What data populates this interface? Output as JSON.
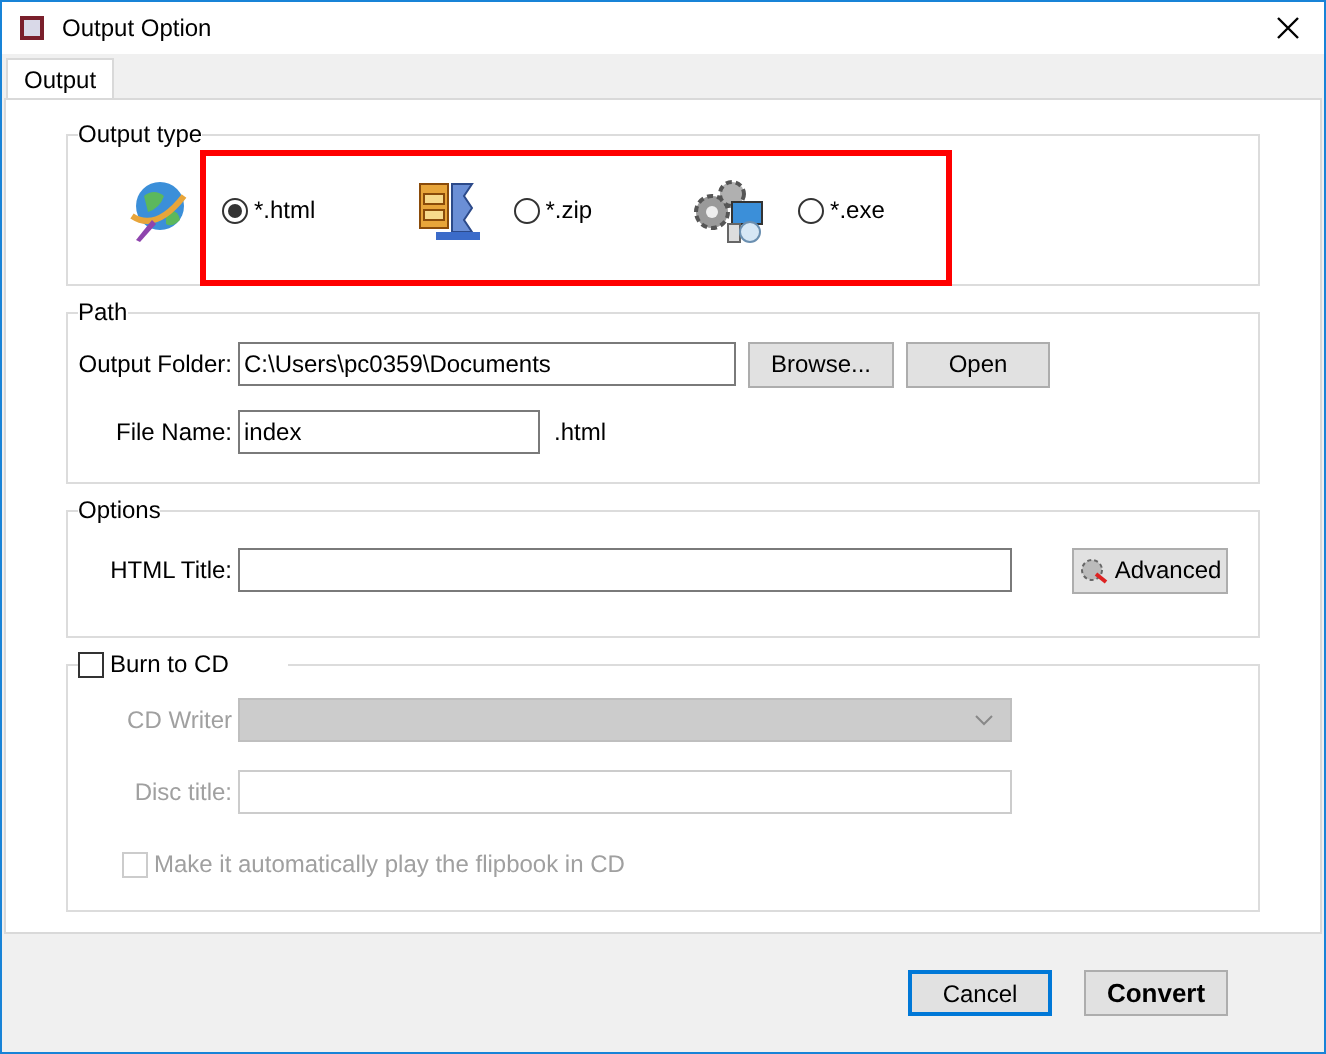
{
  "window": {
    "title": "Output Option"
  },
  "tabs": [
    {
      "label": "Output",
      "selected": true
    }
  ],
  "output_type": {
    "legend": "Output type",
    "options": [
      {
        "kind": "html",
        "label": "*.html",
        "selected": true
      },
      {
        "kind": "zip",
        "label": "*.zip",
        "selected": false
      },
      {
        "kind": "exe",
        "label": "*.exe",
        "selected": false
      }
    ]
  },
  "path": {
    "legend": "Path",
    "output_folder": {
      "label": "Output Folder:",
      "value": "C:\\Users\\pc0359\\Documents"
    },
    "browse": "Browse...",
    "open": "Open",
    "file_name": {
      "label": "File Name:",
      "value": "index"
    },
    "extension": ".html"
  },
  "options": {
    "legend": "Options",
    "html_title": {
      "label": "HTML Title:"
    },
    "advanced": "Advanced"
  },
  "burn": {
    "label": "Burn to CD",
    "checked": false,
    "cd_writer": {
      "label": "CD Writer"
    },
    "disc_title": {
      "label": "Disc title:"
    },
    "autoplay": {
      "label": "Make it automatically play the flipbook in CD",
      "checked": false
    }
  },
  "buttons": [
    {
      "label": "Cancel",
      "kind": "focused"
    },
    {
      "label": "Convert",
      "kind": "bold"
    }
  ]
}
